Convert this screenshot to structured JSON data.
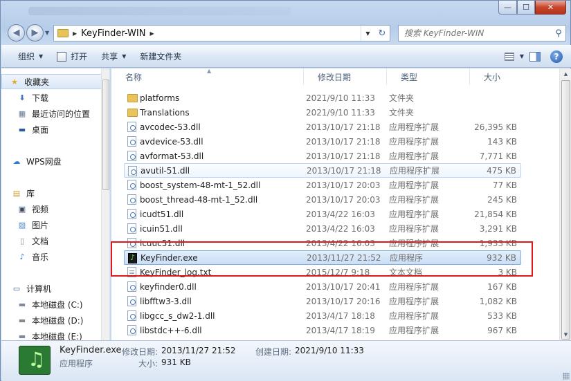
{
  "window": {
    "minimize_glyph": "—",
    "maximize_glyph": "☐",
    "close_glyph": "✕"
  },
  "nav": {
    "back_glyph": "◀",
    "forward_glyph": "▶",
    "path_separator": "▶",
    "path": "KeyFinder-WIN",
    "refresh_glyph": "↻",
    "search_placeholder": "搜索 KeyFinder-WIN",
    "search_icon_glyph": "⚲"
  },
  "toolbar": {
    "organize": "组织",
    "open": "打开",
    "share": "共享",
    "new_folder": "新建文件夹",
    "help": "?"
  },
  "sidebar": {
    "items": [
      {
        "label": "收藏夹",
        "icon": "star-icon",
        "glyph": "★",
        "color": "#e2a824"
      },
      {
        "label": "下载",
        "icon": "download-folder-icon",
        "glyph": "⬇",
        "color": "#3a72c2"
      },
      {
        "label": "最近访问的位置",
        "icon": "recent-places-icon",
        "glyph": "▦",
        "color": "#6b7d95"
      },
      {
        "label": "桌面",
        "icon": "desktop-icon",
        "glyph": "▬",
        "color": "#2e5a9c"
      },
      {
        "label": "WPS网盘",
        "icon": "cloud-icon",
        "glyph": "☁",
        "color": "#2e7bd6"
      },
      {
        "label": "库",
        "icon": "library-icon",
        "glyph": "▤",
        "color": "#c9a033"
      },
      {
        "label": "视频",
        "icon": "video-icon",
        "glyph": "▣",
        "color": "#3a4a60"
      },
      {
        "label": "图片",
        "icon": "pictures-icon",
        "glyph": "▨",
        "color": "#4a8ac9"
      },
      {
        "label": "文档",
        "icon": "documents-icon",
        "glyph": "▯",
        "color": "#7a8aa0"
      },
      {
        "label": "音乐",
        "icon": "music-icon",
        "glyph": "♪",
        "color": "#2a6bc2"
      },
      {
        "label": "计算机",
        "icon": "computer-icon",
        "glyph": "▭",
        "color": "#3a5a86"
      },
      {
        "label": "本地磁盘 (C:)",
        "icon": "drive-c-icon",
        "glyph": "▬",
        "color": "#7f8b99"
      },
      {
        "label": "本地磁盘 (D:)",
        "icon": "drive-d-icon",
        "glyph": "▬",
        "color": "#7f8b99"
      },
      {
        "label": "本地磁盘 (E:)",
        "icon": "drive-e-icon",
        "glyph": "▬",
        "color": "#7f8b99"
      }
    ]
  },
  "columns": {
    "name": "名称",
    "date": "修改日期",
    "type": "类型",
    "size": "大小"
  },
  "files": [
    {
      "name": "platforms",
      "date": "2021/9/10 11:33",
      "type": "文件夹",
      "size": "",
      "kind": "folder"
    },
    {
      "name": "Translations",
      "date": "2021/9/10 11:33",
      "type": "文件夹",
      "size": "",
      "kind": "folder"
    },
    {
      "name": "avcodec-53.dll",
      "date": "2013/10/17 21:18",
      "type": "应用程序扩展",
      "size": "26,395 KB",
      "kind": "dll"
    },
    {
      "name": "avdevice-53.dll",
      "date": "2013/10/17 21:18",
      "type": "应用程序扩展",
      "size": "143 KB",
      "kind": "dll"
    },
    {
      "name": "avformat-53.dll",
      "date": "2013/10/17 21:18",
      "type": "应用程序扩展",
      "size": "7,771 KB",
      "kind": "dll"
    },
    {
      "name": "avutil-51.dll",
      "date": "2013/10/17 21:18",
      "type": "应用程序扩展",
      "size": "475 KB",
      "kind": "dll",
      "state": "hover"
    },
    {
      "name": "boost_system-48-mt-1_52.dll",
      "date": "2013/10/17 20:03",
      "type": "应用程序扩展",
      "size": "77 KB",
      "kind": "dll"
    },
    {
      "name": "boost_thread-48-mt-1_52.dll",
      "date": "2013/10/17 20:03",
      "type": "应用程序扩展",
      "size": "245 KB",
      "kind": "dll"
    },
    {
      "name": "icudt51.dll",
      "date": "2013/4/22 16:03",
      "type": "应用程序扩展",
      "size": "21,854 KB",
      "kind": "dll"
    },
    {
      "name": "icuin51.dll",
      "date": "2013/4/22 16:03",
      "type": "应用程序扩展",
      "size": "3,291 KB",
      "kind": "dll"
    },
    {
      "name": "icuuc51.dll",
      "date": "2013/4/22 16:03",
      "type": "应用程序扩展",
      "size": "1,933 KB",
      "kind": "dll"
    },
    {
      "name": "KeyFinder.exe",
      "date": "2013/11/27 21:52",
      "type": "应用程序",
      "size": "932 KB",
      "kind": "exe",
      "state": "selected"
    },
    {
      "name": "KeyFinder_log.txt",
      "date": "2015/12/7 9:18",
      "type": "文本文档",
      "size": "3 KB",
      "kind": "txt"
    },
    {
      "name": "keyfinder0.dll",
      "date": "2013/10/17 20:41",
      "type": "应用程序扩展",
      "size": "167 KB",
      "kind": "dll"
    },
    {
      "name": "libfftw3-3.dll",
      "date": "2013/10/17 20:16",
      "type": "应用程序扩展",
      "size": "1,082 KB",
      "kind": "dll"
    },
    {
      "name": "libgcc_s_dw2-1.dll",
      "date": "2013/4/17 18:18",
      "type": "应用程序扩展",
      "size": "533 KB",
      "kind": "dll"
    },
    {
      "name": "libstdc++-6.dll",
      "date": "2013/4/17 18:19",
      "type": "应用程序扩展",
      "size": "967 KB",
      "kind": "dll"
    }
  ],
  "details": {
    "filename": "KeyFinder.exe",
    "modified_label": "修改日期:",
    "modified_value": "2013/11/27 21:52",
    "created_label": "创建日期:",
    "created_value": "2021/9/10 11:33",
    "type": "应用程序",
    "size_label": "大小:",
    "size_value": "931 KB"
  },
  "colors": {
    "highlight_border": "#e0181c",
    "selection": "#c9def6"
  }
}
